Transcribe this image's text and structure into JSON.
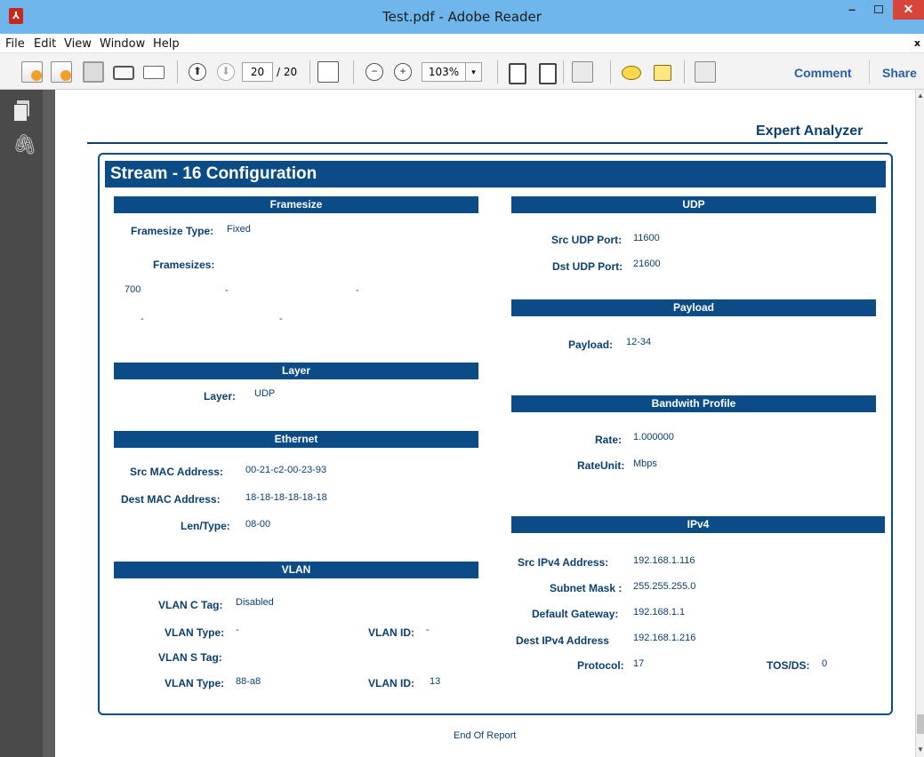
{
  "window": {
    "title": "Test.pdf - Adobe Reader",
    "min_glyph": "–",
    "close_glyph": "✕"
  },
  "menu": {
    "items": [
      "File",
      "Edit",
      "View",
      "Window",
      "Help"
    ],
    "close_glyph": "x"
  },
  "toolbar": {
    "page_current": "20",
    "page_total": "/ 20",
    "zoom": "103%",
    "zoom_arrow": "▾",
    "up_arrow": "⬆",
    "down_arrow": "⬇",
    "zoom_out": "−",
    "zoom_in": "+",
    "comment_label": "Comment",
    "share_label": "Share"
  },
  "nav": {
    "clip_glyph": "🖇"
  },
  "scrollbar": {
    "up": "▲",
    "down": "▼"
  },
  "report": {
    "brand": "Expert Analyzer",
    "title": "Stream - 16  Configuration",
    "framesize": {
      "header": "Framesize",
      "type_label": "Framesize Type:",
      "type_value": "Fixed",
      "sizes_label": "Framesizes:",
      "sizes": [
        "700",
        "-",
        "-",
        "-",
        "-"
      ]
    },
    "layer": {
      "header": "Layer",
      "label": "Layer:",
      "value": "UDP"
    },
    "ethernet": {
      "header": "Ethernet",
      "src_label": "Src MAC Address:",
      "src_value": "00-21-c2-00-23-93",
      "dest_label": "Dest MAC Address:",
      "dest_value": "18-18-18-18-18-18",
      "len_label": "Len/Type:",
      "len_value": "08-00"
    },
    "vlan": {
      "header": "VLAN",
      "ctag_label": "VLAN C Tag:",
      "ctag_value": "Disabled",
      "ctype_label": "VLAN Type:",
      "ctype_value": "-",
      "cid_label": "VLAN ID:",
      "cid_value": "-",
      "stag_label": "VLAN S Tag:",
      "stype_label": "VLAN Type:",
      "stype_value": "88-a8",
      "sid_label": "VLAN ID:",
      "sid_value": "13"
    },
    "udp": {
      "header": "UDP",
      "src_label": "Src UDP Port:",
      "src_value": "11600",
      "dst_label": "Dst UDP Port:",
      "dst_value": "21600"
    },
    "payload": {
      "header": "Payload",
      "label": "Payload:",
      "value": "12-34"
    },
    "bandwidth": {
      "header": "Bandwith Profile",
      "rate_label": "Rate:",
      "rate_value": "1.000000",
      "unit_label": "RateUnit:",
      "unit_value": "Mbps"
    },
    "ipv4": {
      "header": "IPv4",
      "src_label": "Src IPv4 Address:",
      "src_value": "192.168.1.116",
      "mask_label": "Subnet Mask :",
      "mask_value": "255.255.255.0",
      "gw_label": "Default Gateway:",
      "gw_value": "192.168.1.1",
      "dest_label": "Dest IPv4 Address",
      "dest_value": "192.168.1.216",
      "proto_label": "Protocol:",
      "proto_value": "17",
      "tos_label": "TOS/DS:",
      "tos_value": "0"
    },
    "footer": "End Of Report"
  }
}
